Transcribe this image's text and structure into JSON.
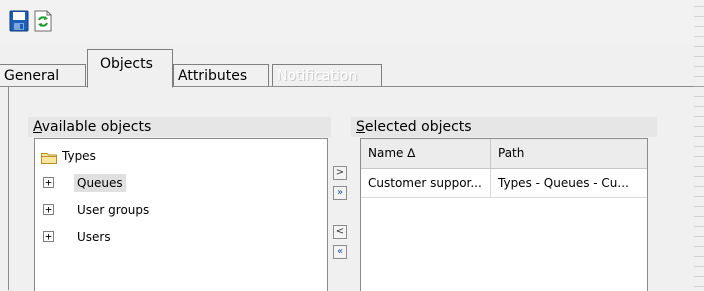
{
  "toolbar": {
    "save_icon": "save-icon",
    "refresh_icon": "refresh-icon"
  },
  "tabs": [
    {
      "label": "General",
      "state": "inactive"
    },
    {
      "label": "Objects",
      "state": "active"
    },
    {
      "label": "Attributes",
      "state": "inactive"
    },
    {
      "label": "Notification",
      "state": "disabled"
    }
  ],
  "available": {
    "title_hotkey": "A",
    "title_rest": "vailable objects",
    "root": {
      "label": "Types",
      "icon": "folder-icon"
    },
    "items": [
      {
        "label": "Queues",
        "expander": "+",
        "selected": true
      },
      {
        "label": "User groups",
        "expander": "+"
      },
      {
        "label": "Users",
        "expander": "+"
      }
    ]
  },
  "move_buttons": {
    "add": ">",
    "add_all": "»",
    "remove": "<",
    "remove_all": "«"
  },
  "selected": {
    "title_hotkey": "S",
    "title_rest": "elected objects",
    "columns": [
      "Name ∆",
      "Path"
    ],
    "rows": [
      [
        "Customer suppor...",
        "Types - Queues - Cu..."
      ]
    ]
  }
}
